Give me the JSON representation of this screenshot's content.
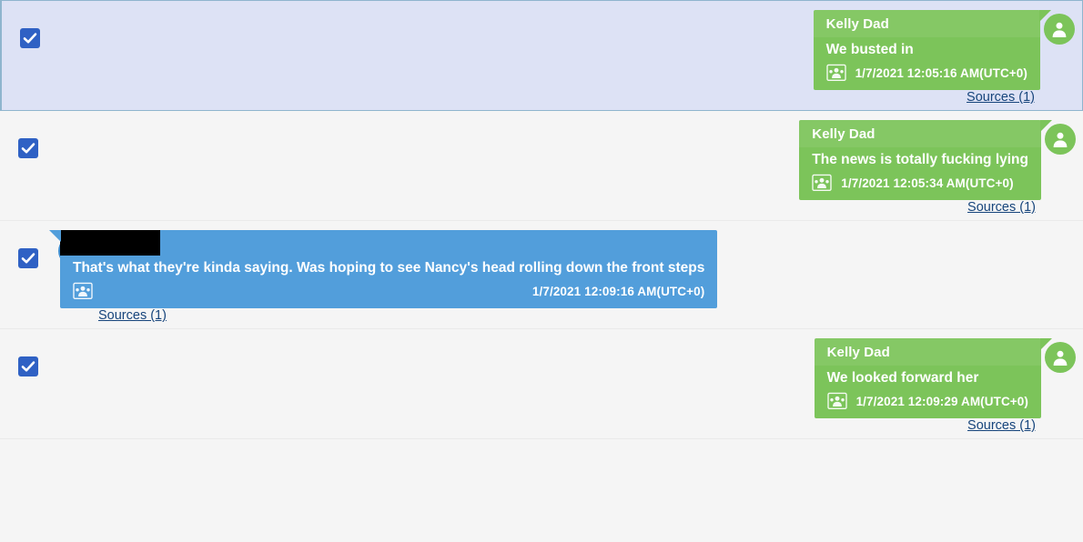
{
  "theme": {
    "page_bg": "#f5f5f5",
    "selected_row_bg": "#dde2f5",
    "selected_row_border": "#8fb5ce",
    "outgoing_bubble": "#7cc45a",
    "incoming_bubble": "#529edb",
    "checkbox_color": "#2f61c4",
    "link_color": "#17457c",
    "redaction_color": "#000000"
  },
  "icons": {
    "checkbox": "checkmark-icon",
    "avatar": "person-avatar-icon",
    "group": "group-participants-icon"
  },
  "messages": [
    {
      "id": "msg-1",
      "selected": true,
      "checked": true,
      "side": "right",
      "sender": "Kelly Dad",
      "sender_redacted": false,
      "text": "We busted in",
      "timestamp": "1/7/2021 12:05:16 AM(UTC+0)",
      "sources_label": "Sources (1)",
      "avatar_color": "green"
    },
    {
      "id": "msg-2",
      "selected": false,
      "checked": true,
      "side": "right",
      "sender": "Kelly Dad",
      "sender_redacted": false,
      "text": "The news is totally fucking lying",
      "timestamp": "1/7/2021 12:05:34 AM(UTC+0)",
      "sources_label": "Sources (1)",
      "avatar_color": "green"
    },
    {
      "id": "msg-3",
      "selected": false,
      "checked": true,
      "side": "left",
      "sender": "",
      "sender_redacted": true,
      "text": "That's what they're kinda saying.  Was hoping to see Nancy's head rolling down the front steps",
      "timestamp": "1/7/2021 12:09:16 AM(UTC+0)",
      "sources_label": "Sources (1)",
      "avatar_color": "blue"
    },
    {
      "id": "msg-4",
      "selected": false,
      "checked": true,
      "side": "right",
      "sender": "Kelly Dad",
      "sender_redacted": false,
      "text": "We looked forward her",
      "timestamp": "1/7/2021 12:09:29 AM(UTC+0)",
      "sources_label": "Sources (1)",
      "avatar_color": "green"
    }
  ]
}
